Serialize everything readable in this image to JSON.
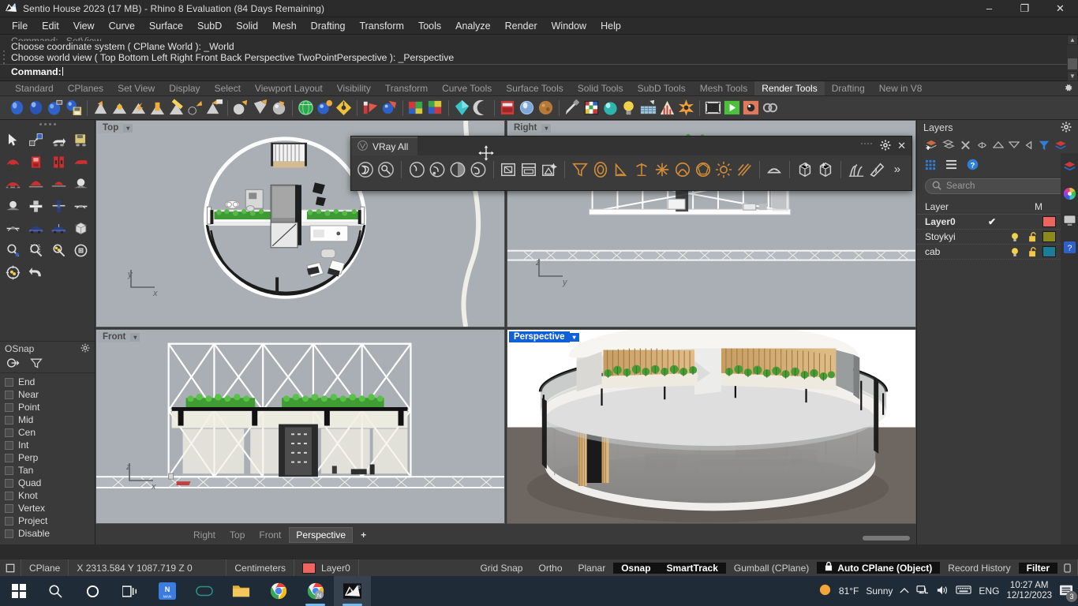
{
  "window": {
    "title": "Sentio House 2023 (17 MB) - Rhino 8 Evaluation (84 Days Remaining)",
    "minimize": "–",
    "maximize": "❐",
    "close": "✕"
  },
  "menubar": {
    "items": [
      "File",
      "Edit",
      "View",
      "Curve",
      "Surface",
      "SubD",
      "Solid",
      "Mesh",
      "Drafting",
      "Transform",
      "Tools",
      "Analyze",
      "Render",
      "Window",
      "Help"
    ]
  },
  "command": {
    "history": [
      "Command: _SetView",
      "Choose coordinate system ( CPlane World ): _World",
      "Choose world view ( Top Bottom Left Right Front Back Perspective TwoPointPerspective ): _Perspective"
    ],
    "prompt": "Command:"
  },
  "toolbar_tabs": {
    "items": [
      "Standard",
      "CPlanes",
      "Set View",
      "Display",
      "Select",
      "Viewport Layout",
      "Visibility",
      "Transform",
      "Curve Tools",
      "Surface Tools",
      "Solid Tools",
      "SubD Tools",
      "Mesh Tools",
      "Render Tools",
      "Drafting",
      "New in V8"
    ],
    "active": "Render Tools",
    "settings_icon": "gear-icon"
  },
  "vray_toolbar": {
    "title": "VRay All",
    "gear_icon": "gear-icon",
    "close_icon": "close-icon",
    "overflow": "»",
    "groups": [
      [
        "vray-render-icon",
        "vray-interactive-render-icon"
      ],
      [
        "vray-frame-buffer-icon",
        "vray-render-last-icon",
        "vray-render-progressive-icon",
        "vray-batch-render-icon"
      ],
      [
        "vray-asset-editor-icon",
        "vray-render-settings-icon",
        "vray-scene-setup-icon"
      ],
      [
        "vray-infinite-plane-icon",
        "vray-proxy-icon",
        "vray-clipper-icon",
        "vray-decal-icon",
        "vray-particles-icon",
        "vray-dome-light-icon",
        "vray-sphere-light-icon",
        "vray-sun-light-icon",
        "vray-ies-light-icon"
      ],
      [
        "vray-mesh-light-icon"
      ],
      [
        "vray-proxy-import-icon",
        "vray-proxy-export-icon"
      ],
      [
        "vray-fur-icon",
        "vray-displacement-icon"
      ]
    ]
  },
  "left_tools": {
    "rows": [
      [
        "arrow-select-icon",
        "select-objects-icon",
        "select-previous-icon",
        "save-selection-icon"
      ],
      [
        "zoom-extents-icon",
        "zoom-window-icon",
        "zoom-selected-icon",
        "zoom-in-out-icon"
      ],
      [
        "pan-view-icon",
        "named-view-icon",
        "view-front-icon",
        "view-sphere-icon"
      ],
      [
        "set-view-icon",
        "rotate-view-icon",
        "tilt-view-icon",
        "bounding-box-icon"
      ],
      [
        "zoom-target-icon",
        "zoom-marquee-icon",
        "zoom-dynamic-icon",
        "zoom-center-icon"
      ],
      [
        "zoom-lens-icon",
        "undo-view-icon"
      ]
    ]
  },
  "osnap": {
    "title": "OSnap",
    "gear_icon": "gear-icon",
    "tabs": [
      "osnap-tab-icon",
      "filter-tab-icon"
    ],
    "items": [
      {
        "label": "End",
        "checked": false
      },
      {
        "label": "Near",
        "checked": false
      },
      {
        "label": "Point",
        "checked": false
      },
      {
        "label": "Mid",
        "checked": false
      },
      {
        "label": "Cen",
        "checked": false
      },
      {
        "label": "Int",
        "checked": false
      },
      {
        "label": "Perp",
        "checked": false
      },
      {
        "label": "Tan",
        "checked": false
      },
      {
        "label": "Quad",
        "checked": false
      },
      {
        "label": "Knot",
        "checked": false
      },
      {
        "label": "Vertex",
        "checked": false
      },
      {
        "label": "Project",
        "checked": false
      },
      {
        "label": "Disable",
        "checked": false
      }
    ]
  },
  "viewports": {
    "top": {
      "label": "Top",
      "active": false,
      "axes": [
        "y",
        "x"
      ]
    },
    "right": {
      "label": "Right",
      "active": false,
      "axes": [
        "z",
        "y"
      ]
    },
    "front": {
      "label": "Front",
      "active": false,
      "axes": [
        "z",
        "x"
      ]
    },
    "persp": {
      "label": "Perspective",
      "active": true,
      "axes": []
    },
    "dropdown_glyph": "▾"
  },
  "viewport_tabs": {
    "items": [
      "Right",
      "Top",
      "Front",
      "Perspective"
    ],
    "active": "Perspective",
    "add": "+"
  },
  "layers_panel": {
    "title": "Layers",
    "gear_icon": "gear-icon",
    "tools": [
      "new-layer-icon",
      "new-sublayer-icon",
      "delete-layer-icon",
      "select-objects-icon",
      "move-up-icon",
      "move-down-icon",
      "set-current-icon",
      "filter-icon",
      "layer-colors-icon"
    ],
    "tools2": [
      "grid-view-icon",
      "list-view-icon",
      "help-icon"
    ],
    "search": {
      "placeholder": "Search",
      "value": ""
    },
    "columns": [
      "Layer",
      "",
      "",
      "",
      "",
      "M"
    ],
    "rows": [
      {
        "name": "Layer0",
        "current": true,
        "check": "✔",
        "bulb": "",
        "lock": "",
        "color": "#f0645f",
        "material": "white"
      },
      {
        "name": "Stoykyi",
        "current": false,
        "check": "",
        "bulb": "bulb-icon",
        "lock": "unlock-icon",
        "color": "#8a8a1e",
        "material": "white"
      },
      {
        "name": "cab",
        "current": false,
        "check": "",
        "bulb": "bulb-icon",
        "lock": "unlock-icon",
        "color": "#1d7c96",
        "material": "white"
      }
    ],
    "edge_tabs": [
      "layers-tab-icon",
      "color-wheel-tab-icon",
      "display-tab-icon",
      "help-tab-icon"
    ]
  },
  "statusbar": {
    "cplane_label": "CPlane",
    "coords": "X 2313.584 Y 1087.719 Z 0",
    "units": "Centimeters",
    "layer_color": "#f0645f",
    "layer": "Layer0",
    "toggles": [
      {
        "label": "Grid Snap",
        "on": false
      },
      {
        "label": "Ortho",
        "on": false
      },
      {
        "label": "Planar",
        "on": false
      },
      {
        "label": "Osnap",
        "on": true
      },
      {
        "label": "SmartTrack",
        "on": true
      },
      {
        "label": "Gumball (CPlane)",
        "on": false
      },
      {
        "label": "Auto CPlane (Object)",
        "on": true,
        "lock_icon": "lock-icon"
      },
      {
        "label": "Record History",
        "on": false
      },
      {
        "label": "Filter",
        "on": true
      }
    ]
  },
  "taskbar": {
    "items": [
      "start-icon",
      "search-icon",
      "cortana-icon",
      "task-view-icon",
      "nordvpn-icon",
      "widget-icon",
      "file-explorer-icon",
      "chrome-icon",
      "chrome-profile-icon",
      "rhino-icon"
    ],
    "weather": {
      "temp": "81°F",
      "condition": "Sunny",
      "icon": "sun-icon"
    },
    "tray": [
      "chevron-up-icon",
      "network-icon",
      "volume-icon",
      "keyboard-icon"
    ],
    "language": "ENG",
    "time": "10:27 AM",
    "date": "12/12/2023",
    "notifications": {
      "icon": "notification-icon",
      "count": "3"
    }
  }
}
